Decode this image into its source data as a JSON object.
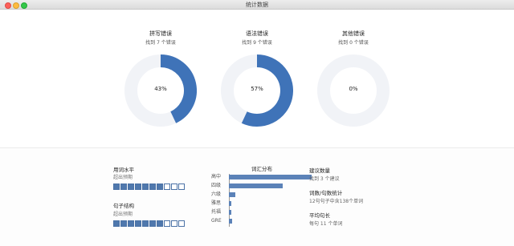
{
  "window": {
    "title": "统计数据"
  },
  "gauges": [
    {
      "title": "拼写错误",
      "subtitle": "找到 7 个错误",
      "percent_label": "43%",
      "value": 0.43,
      "color": "#3f73b8",
      "track": "#f1f3f7"
    },
    {
      "title": "语法错误",
      "subtitle": "找到 9 个错误",
      "percent_label": "57%",
      "value": 0.57,
      "color": "#3f73b8",
      "track": "#f1f3f7"
    },
    {
      "title": "其他错误",
      "subtitle": "找到 0 个错误",
      "percent_label": "0%",
      "value": 0.0,
      "color": "#3f73b8",
      "track": "#f1f3f7"
    }
  ],
  "vocab_level": {
    "title": "用词水平",
    "subtitle": "超出预期",
    "filled": 7,
    "total": 10
  },
  "sentence_structure": {
    "title": "句子结构",
    "subtitle": "超出预期",
    "filled": 7,
    "total": 10
  },
  "distribution": {
    "title": "词汇分布",
    "rows": [
      {
        "label": "高中",
        "value": 0.94
      },
      {
        "label": "四级",
        "value": 0.61
      },
      {
        "label": "六级",
        "value": 0.07
      },
      {
        "label": "雅思",
        "value": 0.03
      },
      {
        "label": "托福",
        "value": 0.03
      },
      {
        "label": "GRE",
        "value": 0.04
      }
    ]
  },
  "stats": {
    "suggestions_title": "建议数量",
    "suggestions_value": "找到 3 个建议",
    "counts_title": "词数/句数统计",
    "counts_value": "12句句子中含138个单词",
    "avg_title": "平均句长",
    "avg_value": "每句 11 个单词"
  },
  "colors": {
    "accent": "#3f73b8",
    "bar": "#5b82b8"
  }
}
